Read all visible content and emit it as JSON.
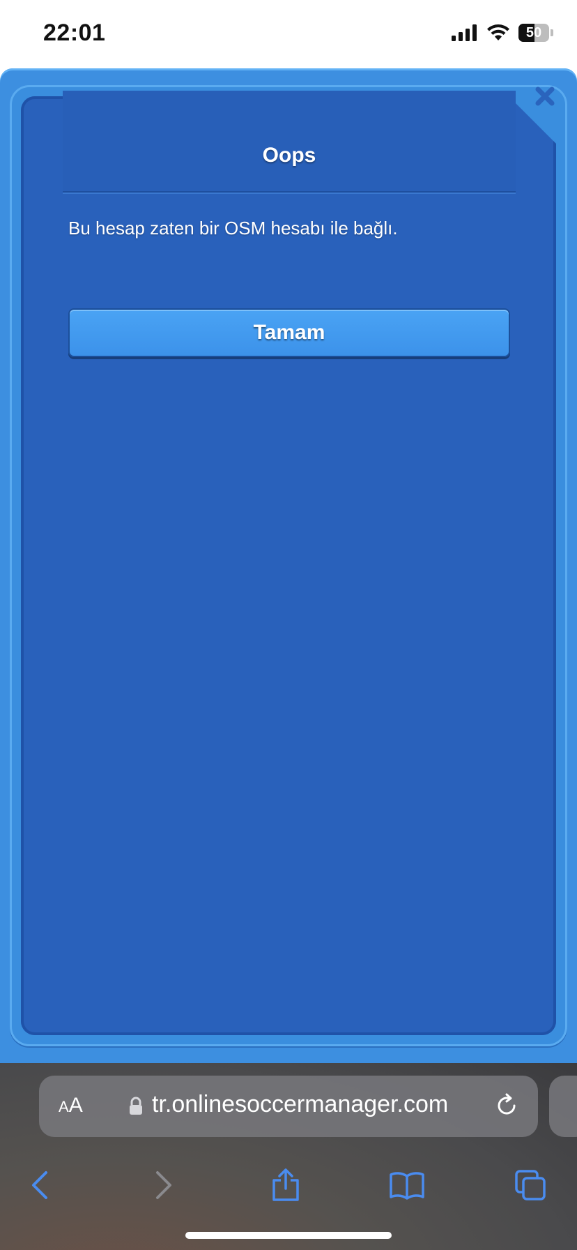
{
  "status_bar": {
    "time": "22:01",
    "battery_level": "50"
  },
  "dialog": {
    "title": "Oops",
    "message": "Bu hesap zaten bir OSM hesabı ile bağlı.",
    "ok_label": "Tamam",
    "close_icon": "close-icon"
  },
  "browser": {
    "aa_label_small": "A",
    "aa_label_large": "A",
    "url": "tr.onlinesoccermanager.com",
    "toolbar_icons": [
      "back-icon",
      "forward-icon",
      "share-icon",
      "bookmarks-icon",
      "tabs-icon"
    ]
  },
  "colors": {
    "panel": "#2961bb",
    "frame": "#3d8fe0",
    "button": "#4aa3f4",
    "toolbar_icon": "#4a8cf0"
  }
}
